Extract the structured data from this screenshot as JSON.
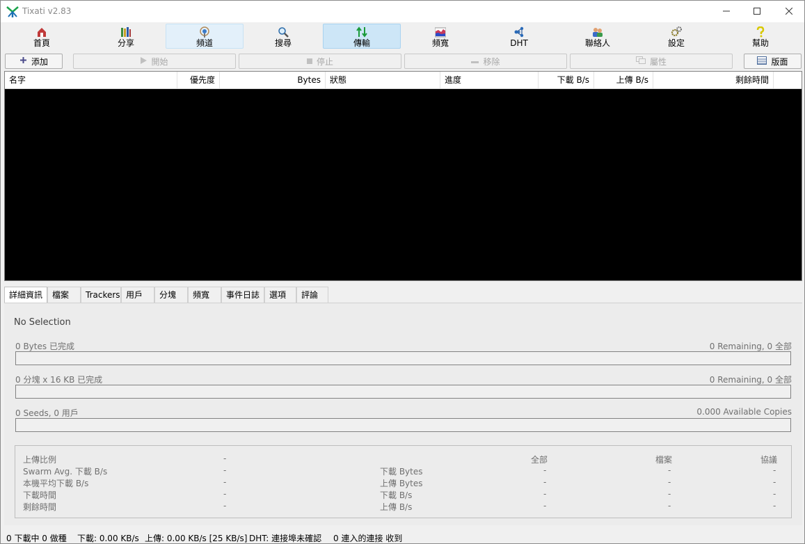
{
  "window": {
    "title": "Tixati v2.83"
  },
  "toolbar": {
    "items": [
      {
        "label": "首頁",
        "icon": "home-icon"
      },
      {
        "label": "分享",
        "icon": "books-icon"
      },
      {
        "label": "頻道",
        "icon": "broadcast-icon"
      },
      {
        "label": "搜尋",
        "icon": "magnifier-icon"
      },
      {
        "label": "傳輸",
        "icon": "transfer-arrows-icon"
      },
      {
        "label": "頻寬",
        "icon": "bandwidth-graph-icon"
      },
      {
        "label": "DHT",
        "icon": "network-nodes-icon"
      },
      {
        "label": "聯絡人",
        "icon": "people-icon"
      },
      {
        "label": "設定",
        "icon": "gears-icon"
      },
      {
        "label": "幫助",
        "icon": "question-icon"
      }
    ]
  },
  "actions": {
    "add": "添加",
    "start": "開始",
    "stop": "停止",
    "remove": "移除",
    "properties": "屬性",
    "layout": "版面"
  },
  "table": {
    "columns": [
      "名字",
      "優先度",
      "Bytes",
      "狀態",
      "進度",
      "下載 B/s",
      "上傳 B/s",
      "剩餘時間"
    ]
  },
  "tabs": [
    "詳細資訊",
    "檔案",
    "Trackers",
    "用戶",
    "分塊",
    "頻寬",
    "事件日誌",
    "選項",
    "評論"
  ],
  "details": {
    "no_selection": "No Selection",
    "bytes_done": "0 Bytes 已完成",
    "bytes_remaining": "0 Remaining,  0 全部",
    "pieces_done": "0 分塊  x  16 KB 已完成",
    "pieces_remaining": "0 Remaining,  0 全部",
    "seeds_users": "0 Seeds, 0 用戶",
    "available_copies": "0.000 Available Copies",
    "left_stats": [
      {
        "label": "上傳比例",
        "value": "-"
      },
      {
        "label": "Swarm Avg. 下載 B/s",
        "value": "-"
      },
      {
        "label": "本機平均下載 B/s",
        "value": "-"
      },
      {
        "label": "下載時間",
        "value": "-"
      },
      {
        "label": "剩餘時間",
        "value": "-"
      }
    ],
    "right_headers": {
      "all": "全部",
      "files": "檔案",
      "protocol": "協議"
    },
    "right_stats": [
      {
        "label": "下載 Bytes",
        "all": "-",
        "files": "-",
        "protocol": "-"
      },
      {
        "label": "上傳 Bytes",
        "all": "-",
        "files": "-",
        "protocol": "-"
      },
      {
        "label": "下載 B/s",
        "all": "-",
        "files": "-",
        "protocol": "-"
      },
      {
        "label": "上傳 B/s",
        "all": "-",
        "files": "-",
        "protocol": "-"
      }
    ]
  },
  "status": {
    "downloading": "0 下載中  0 做種",
    "download": "下載: 0.00 KB/s",
    "upload": "上傳: 0.00 KB/s [25 KB/s]",
    "dht": "DHT: 連接埠未確認",
    "incoming": "0 連入的連接 收到"
  },
  "colors": {
    "active_tab_bg": "#cde6f7",
    "table_bg": "#000000"
  }
}
